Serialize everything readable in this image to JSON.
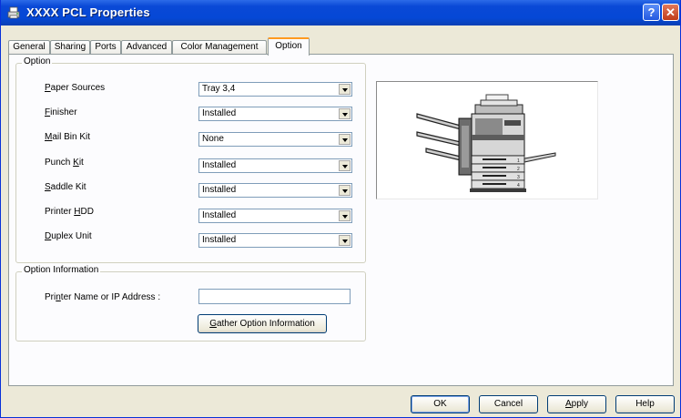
{
  "window": {
    "title": "XXXX PCL Properties"
  },
  "tabs": [
    "General",
    "Sharing",
    "Ports",
    "Advanced",
    "Color Management",
    "Option"
  ],
  "option_group": {
    "title": "Option",
    "rows": [
      {
        "label_pre": "",
        "label_key": "P",
        "label_post": "aper Sources",
        "value": "Tray 3,4"
      },
      {
        "label_pre": "",
        "label_key": "F",
        "label_post": "inisher",
        "value": "Installed"
      },
      {
        "label_pre": "",
        "label_key": "M",
        "label_post": "ail Bin Kit",
        "value": "None"
      },
      {
        "label_pre": "Punch ",
        "label_key": "K",
        "label_post": "it",
        "value": "Installed"
      },
      {
        "label_pre": "",
        "label_key": "S",
        "label_post": "addle Kit",
        "value": "Installed"
      },
      {
        "label_pre": "Printer ",
        "label_key": "H",
        "label_post": "DD",
        "value": "Installed"
      },
      {
        "label_pre": "",
        "label_key": "D",
        "label_post": "uplex Unit",
        "value": "Installed"
      }
    ]
  },
  "info_group": {
    "title": "Option Information",
    "address_label_pre": "Pri",
    "address_label_key": "n",
    "address_label_post": "ter Name or IP Address :",
    "address_value": "",
    "gather_pre": "",
    "gather_key": "G",
    "gather_post": "ather Option Information"
  },
  "buttons": {
    "ok": "OK",
    "cancel": "Cancel",
    "apply_key": "A",
    "apply_post": "pply",
    "help": "Help"
  }
}
